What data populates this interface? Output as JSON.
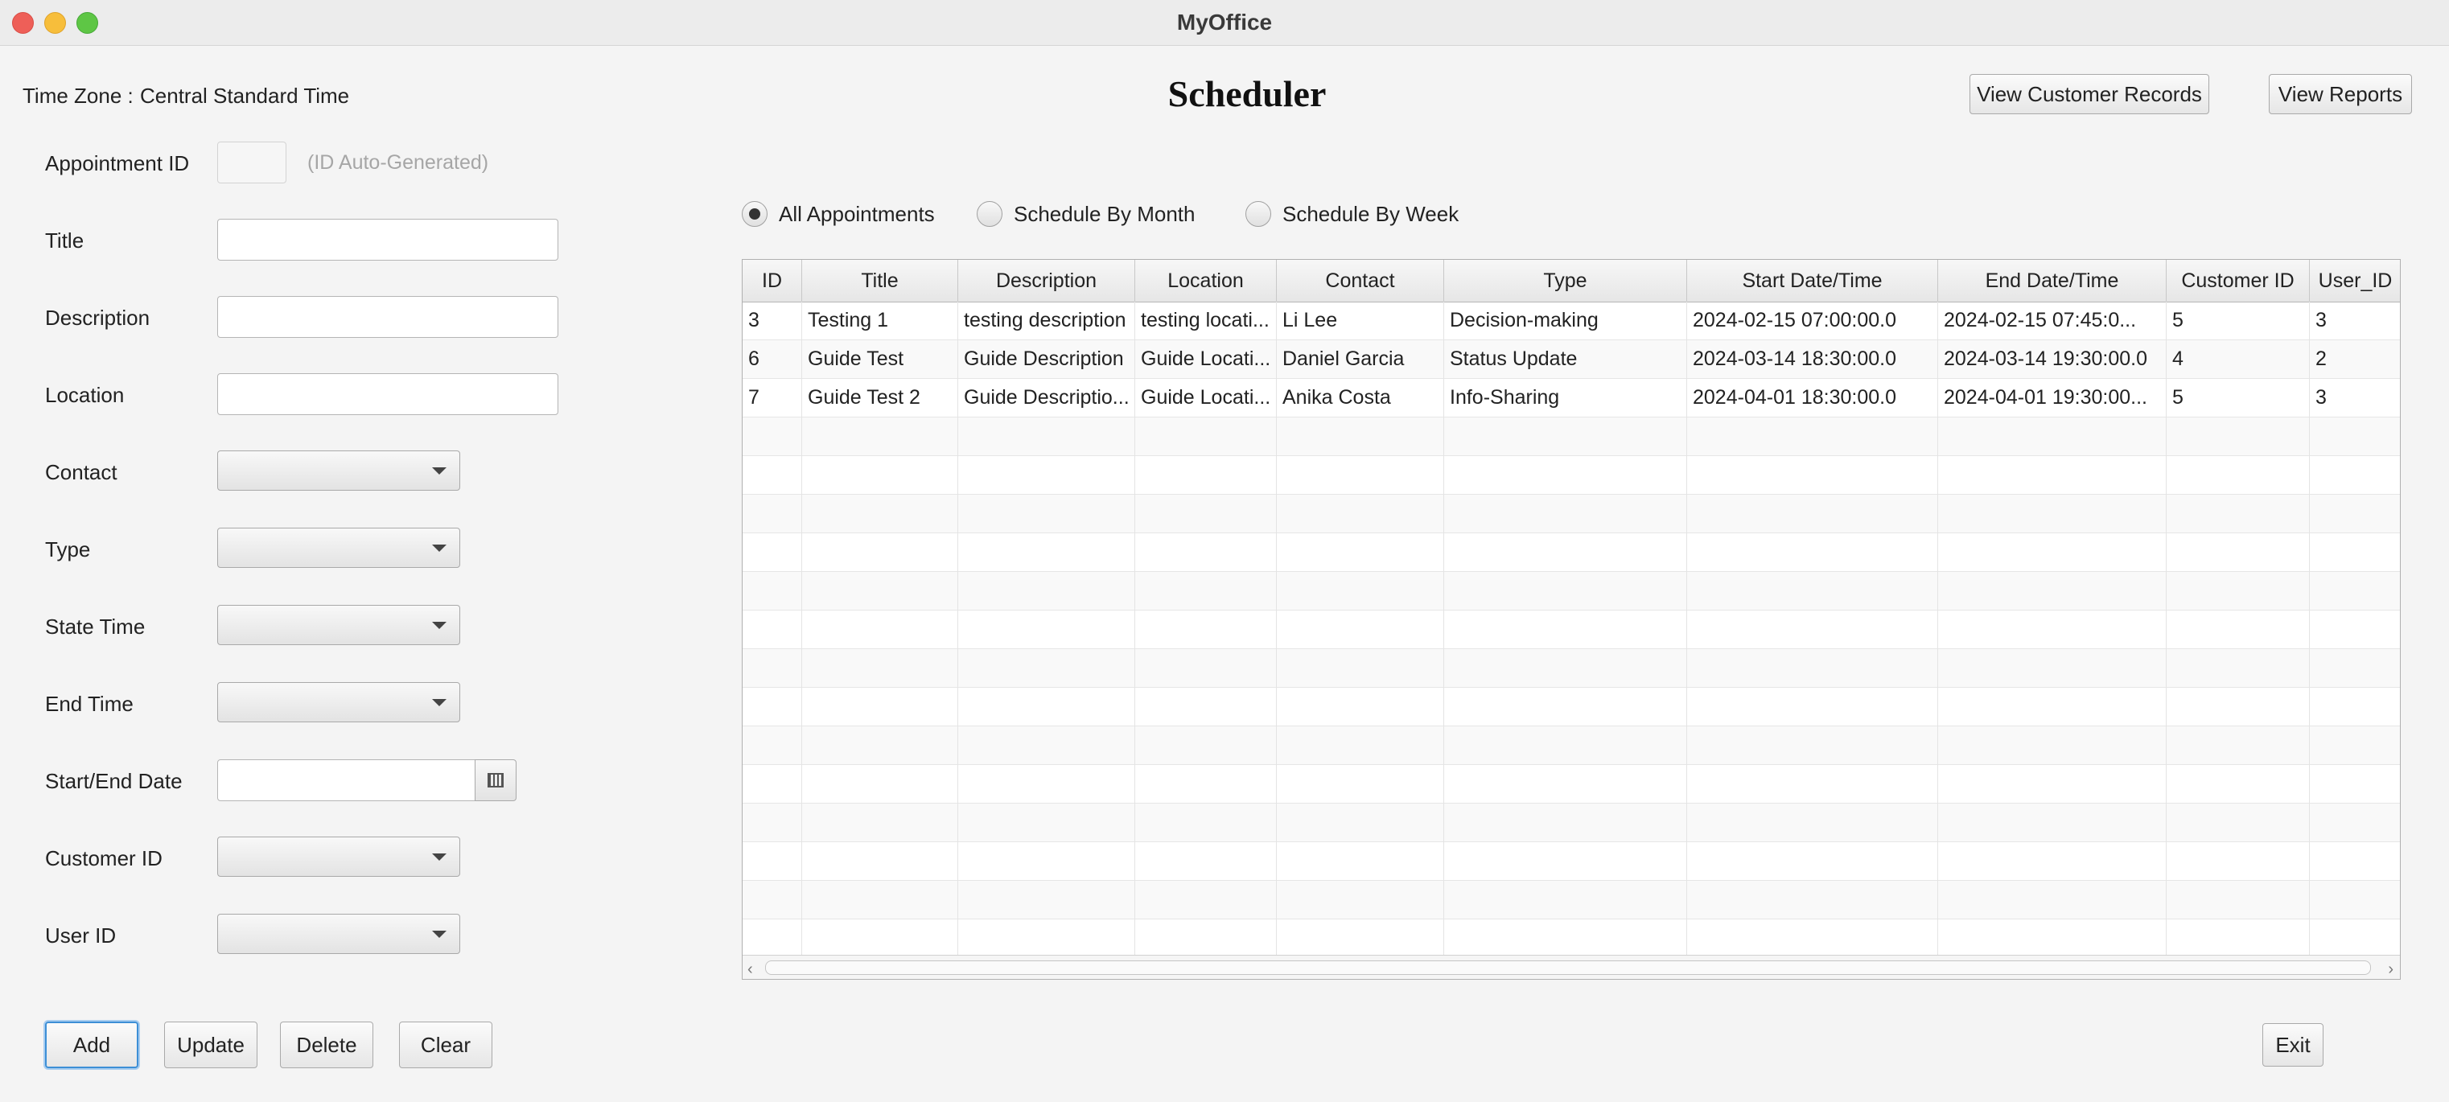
{
  "window": {
    "title": "MyOffice"
  },
  "header": {
    "time_zone_label": "Time Zone :",
    "time_zone_value": "Central Standard Time",
    "title": "Scheduler",
    "view_customer_records": "View Customer Records",
    "view_reports": "View Reports"
  },
  "form": {
    "appointment_id_label": "Appointment ID",
    "appointment_id_hint": "(ID Auto-Generated)",
    "title_label": "Title",
    "description_label": "Description",
    "location_label": "Location",
    "contact_label": "Contact",
    "type_label": "Type",
    "start_time_label": "State Time",
    "end_time_label": "End Time",
    "date_label": "Start/End Date",
    "customer_id_label": "Customer ID",
    "user_id_label": "User ID"
  },
  "actions": {
    "add": "Add",
    "update": "Update",
    "delete": "Delete",
    "clear": "Clear",
    "exit": "Exit"
  },
  "filters": {
    "all": "All Appointments",
    "month": "Schedule By Month",
    "week": "Schedule By Week",
    "selected": "all"
  },
  "table": {
    "columns": [
      "ID",
      "Title",
      "Description",
      "Location",
      "Contact",
      "Type",
      "Start Date/Time",
      "End Date/Time",
      "Customer ID",
      "User_ID"
    ],
    "rows": [
      [
        "3",
        "Testing 1",
        "testing description",
        "testing locati...",
        "Li Lee",
        "Decision-making",
        "2024-02-15 07:00:00.0",
        "2024-02-15 07:45:0...",
        "5",
        "3"
      ],
      [
        "6",
        "Guide Test",
        "Guide Description",
        "Guide Locati...",
        "Daniel Garcia",
        "Status Update",
        "2024-03-14 18:30:00.0",
        "2024-03-14 19:30:00.0",
        "4",
        "2"
      ],
      [
        "7",
        "Guide Test 2",
        "Guide Descriptio...",
        "Guide Locati...",
        "Anika Costa",
        "Info-Sharing",
        "2024-04-01 18:30:00.0",
        "2024-04-01 19:30:00...",
        "5",
        "3"
      ]
    ],
    "empty_rows": 14
  },
  "icons": {
    "calendar": "calendar-icon",
    "dropdown": "chevron-down-icon",
    "scroll_left": "‹",
    "scroll_right": "›"
  }
}
